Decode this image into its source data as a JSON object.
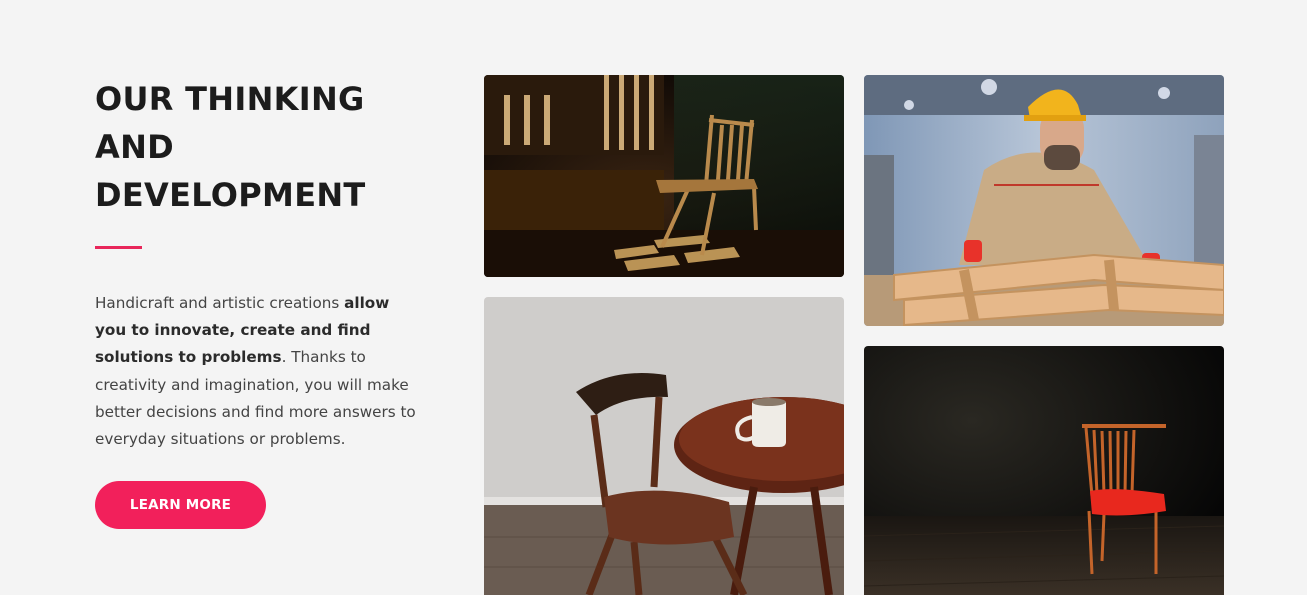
{
  "section": {
    "title_lines": [
      "OUR THINKING",
      "AND",
      "DEVELOPMENT"
    ],
    "accent_color": "#e8265a",
    "description": {
      "part1": "Handicraft and artistic creations ",
      "bold": "allow you to innovate, create and find solutions to problems",
      "part2": ". Thanks to creativity and imagination, you will make better decisions and find more answers to everyday situations or problems."
    },
    "cta_label": "LEARN MORE",
    "cta_color": "#f2205b"
  },
  "gallery": [
    {
      "name": "chair-by-window-photo"
    },
    {
      "name": "wooden-chair-and-table-photo"
    },
    {
      "name": "carpenter-with-hard-hat-photo"
    },
    {
      "name": "red-chair-dark-room-photo"
    }
  ]
}
